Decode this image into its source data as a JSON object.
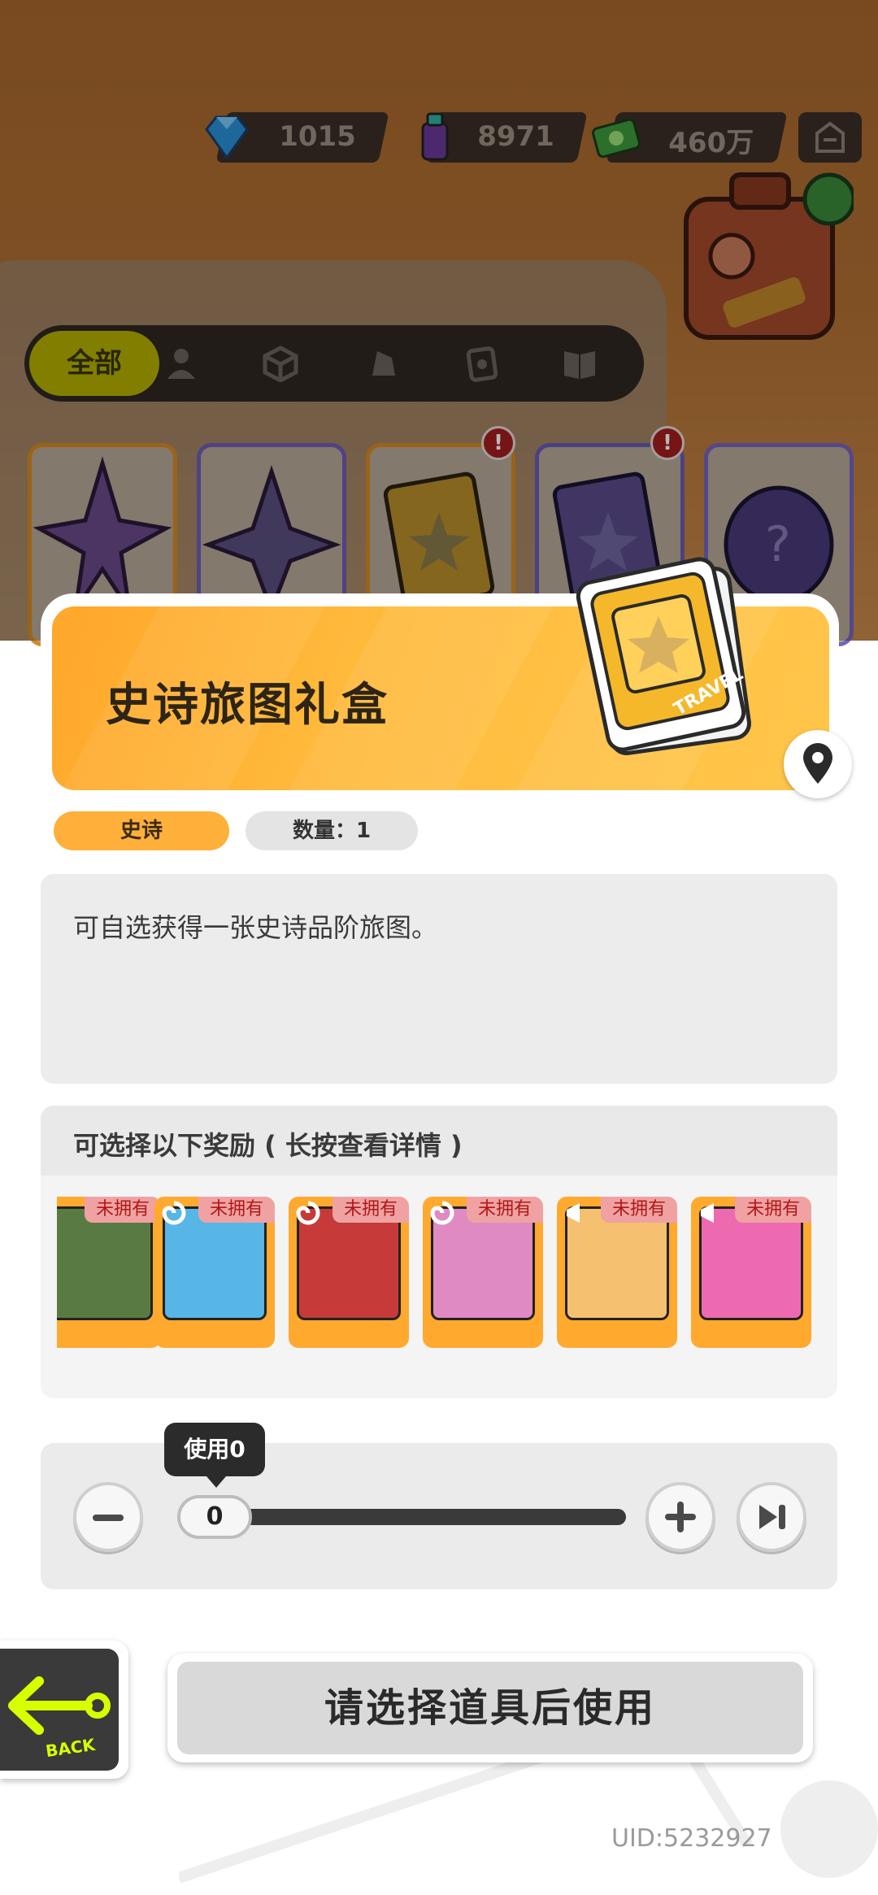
{
  "currencies": [
    {
      "icon": "gem-icon",
      "value": "1015"
    },
    {
      "icon": "spray-can-icon",
      "value": "8971"
    },
    {
      "icon": "cash-icon",
      "value": "460万"
    }
  ],
  "tabs": {
    "active_label": "全部",
    "icons": [
      "person-icon",
      "box-icon",
      "shoe-icon",
      "card-icon",
      "book-icon"
    ]
  },
  "background_items": [
    {
      "icon": "rainbow-star-icon",
      "color": "#e39a2a",
      "badge": null
    },
    {
      "icon": "purple-star-icon",
      "color": "#7b68c6",
      "badge": null
    },
    {
      "icon": "gold-card-icon",
      "color": "#e39a2a",
      "badge": "!"
    },
    {
      "icon": "purple-card-icon",
      "color": "#6e5ab8",
      "badge": "!"
    },
    {
      "icon": "mystery-egg-icon",
      "color": "#7b68c6",
      "badge": null
    }
  ],
  "item": {
    "title": "史诗旅图礼盒",
    "rarity": "史诗",
    "quantity_label": "数量：1",
    "description": "可自选获得一张史诗品阶旅图。"
  },
  "rewards": {
    "title": "可选择以下奖励 ( 长按查看详情 )",
    "unowned_tag": "未拥有",
    "cards": [
      {
        "art_color": "#4a6a3a"
      },
      {
        "art_color": "#3aa3d8"
      },
      {
        "art_color": "#c42a2a"
      },
      {
        "art_color": "#d870b0"
      },
      {
        "art_color": "#f2a640"
      },
      {
        "art_color": "#e84aa0"
      }
    ]
  },
  "slider": {
    "tooltip": "使用0",
    "value": "0"
  },
  "back_label": "BACK",
  "use_button_label": "请选择道具后使用",
  "uid": "UID:5232927",
  "colors": {
    "accent_orange": "#ffb03a",
    "unowned_red": "#b01818"
  }
}
